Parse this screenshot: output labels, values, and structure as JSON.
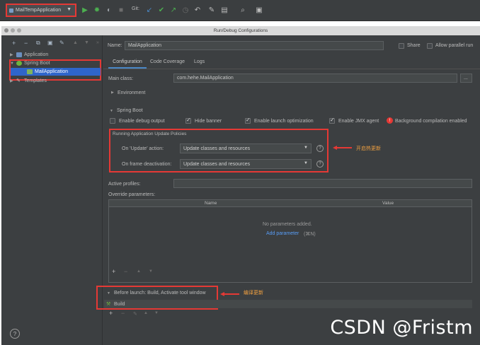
{
  "toolbar": {
    "run_config": "MailTempApplication",
    "git_label": "Git:"
  },
  "dialog": {
    "title": "Run/Debug Configurations"
  },
  "tree": {
    "application": "Application",
    "spring_boot": "Spring Boot",
    "mail_application": "MailApplication",
    "templates": "Templates"
  },
  "form": {
    "name_label": "Name:",
    "name_value": "MailApplication",
    "share_label": "Share",
    "parallel_label": "Allow parallel run",
    "tabs": [
      "Configuration",
      "Code Coverage",
      "Logs"
    ],
    "main_class_label": "Main class:",
    "main_class_value": "com.hehe.MailApplication",
    "main_class_button": "...",
    "environment_label": "Environment",
    "spring_boot_section": "Spring Boot",
    "enable_debug": "Enable debug output",
    "hide_banner": "Hide banner",
    "launch_opt": "Enable launch optimization",
    "jmx_agent": "Enable JMX agent",
    "bg_compilation": "Background compilation enabled",
    "policies_title": "Running Application Update Policies",
    "on_update_label": "On 'Update' action:",
    "on_update_value": "Update classes and resources",
    "on_frame_label": "On frame deactivation:",
    "on_frame_value": "Update classes and resources",
    "active_profiles_label": "Active profiles:",
    "override_label": "Override parameters:",
    "col_name": "Name",
    "col_value": "Value",
    "no_params": "No parameters added.",
    "add_param": "Add parameter",
    "add_param_shortcut": "(⌘N)",
    "before_launch": "Before launch: Build, Activate tool window",
    "build": "Build"
  },
  "annotations": {
    "hot_reload": "开启热更新",
    "compile_update": "编译更新"
  },
  "watermark": "CSDN @Fristm",
  "help_mark": "?",
  "colors": {
    "highlight": "#e53935",
    "selection": "#2f65ca",
    "annotation": "#f0a040"
  }
}
